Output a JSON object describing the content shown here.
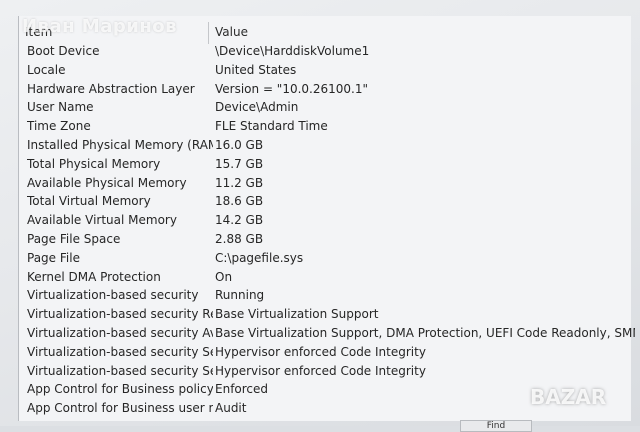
{
  "watermark": "Иван Маринов",
  "logo": "BAZAR",
  "table": {
    "header": {
      "item": "Item",
      "value": "Value"
    },
    "rows": [
      {
        "item": "Boot Device",
        "value": "\\Device\\HarddiskVolume1"
      },
      {
        "item": "Locale",
        "value": "United States"
      },
      {
        "item": "Hardware Abstraction Layer",
        "value": "Version = \"10.0.26100.1\""
      },
      {
        "item": "User Name",
        "value": "Device\\Admin"
      },
      {
        "item": "Time Zone",
        "value": "FLE Standard Time"
      },
      {
        "item": "Installed Physical Memory (RAM)",
        "value": "16.0 GB"
      },
      {
        "item": "Total Physical Memory",
        "value": "15.7 GB"
      },
      {
        "item": "Available Physical Memory",
        "value": "11.2 GB"
      },
      {
        "item": "Total Virtual Memory",
        "value": "18.6 GB"
      },
      {
        "item": "Available Virtual Memory",
        "value": "14.2 GB"
      },
      {
        "item": "Page File Space",
        "value": "2.88 GB"
      },
      {
        "item": "Page File",
        "value": "C:\\pagefile.sys"
      },
      {
        "item": "Kernel DMA Protection",
        "value": "On"
      },
      {
        "item": "Virtualization-based security",
        "value": "Running"
      },
      {
        "item": "Virtualization-based security Re...",
        "value": "Base Virtualization Support"
      },
      {
        "item": "Virtualization-based security Av...",
        "value": "Base Virtualization Support, DMA Protection, UEFI Code Readonly, SMM Securi..."
      },
      {
        "item": "Virtualization-based security Se...",
        "value": "Hypervisor enforced Code Integrity"
      },
      {
        "item": "Virtualization-based security Se...",
        "value": "Hypervisor enforced Code Integrity"
      },
      {
        "item": "App Control for Business policy",
        "value": "Enforced"
      },
      {
        "item": "App Control for Business user m...",
        "value": "Audit"
      }
    ]
  },
  "find_button": "Find"
}
